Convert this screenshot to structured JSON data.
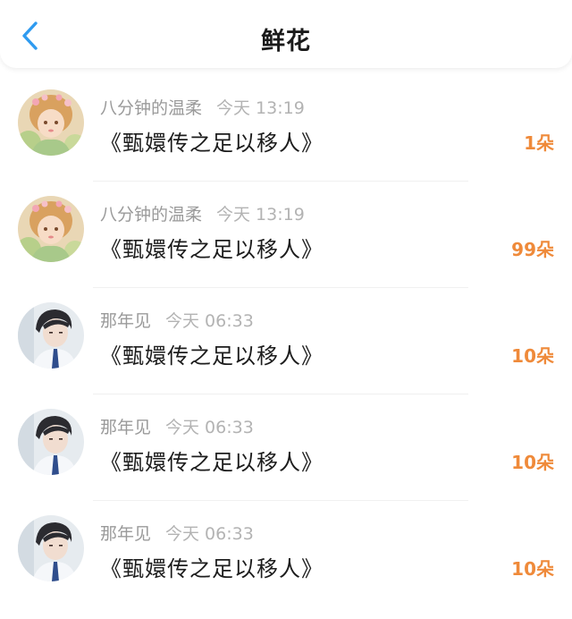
{
  "header": {
    "title": "鲜花",
    "back_icon": "back-arrow-icon"
  },
  "colors": {
    "accent_back": "#2f9bf0",
    "count_orange": "#ef8a3a",
    "meta_gray": "#9a9a9a"
  },
  "items": [
    {
      "user": "八分钟的温柔",
      "time": "今天 13:19",
      "book": "《甄嬛传之足以移人》",
      "count": "1朵",
      "avatar": "girl-avatar"
    },
    {
      "user": "八分钟的温柔",
      "time": "今天 13:19",
      "book": "《甄嬛传之足以移人》",
      "count": "99朵",
      "avatar": "girl-avatar"
    },
    {
      "user": "那年见",
      "time": "今天 06:33",
      "book": "《甄嬛传之足以移人》",
      "count": "10朵",
      "avatar": "man-avatar"
    },
    {
      "user": "那年见",
      "time": "今天 06:33",
      "book": "《甄嬛传之足以移人》",
      "count": "10朵",
      "avatar": "man-avatar"
    },
    {
      "user": "那年见",
      "time": "今天 06:33",
      "book": "《甄嬛传之足以移人》",
      "count": "10朵",
      "avatar": "man-avatar"
    }
  ]
}
